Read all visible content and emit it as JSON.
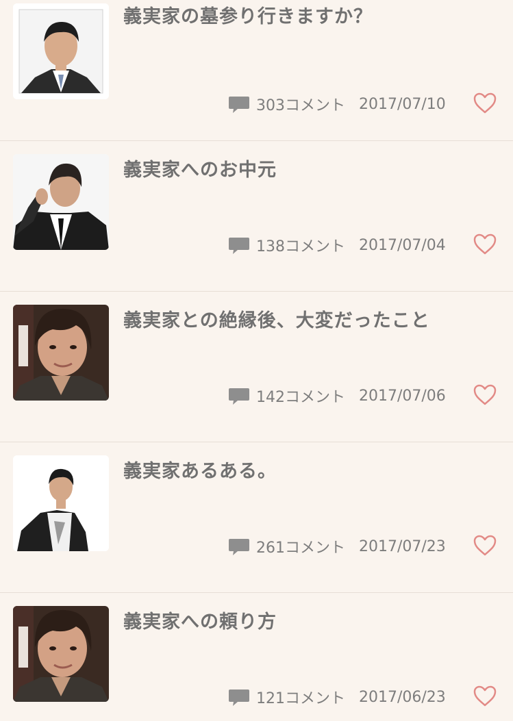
{
  "items": [
    {
      "title": "義実家の墓参り行きますか？",
      "comments": "303コメント",
      "date": "2017/07/10",
      "thumbnail": "man-suit-white-bg"
    },
    {
      "title": "義実家へのお中元",
      "comments": "138コメント",
      "date": "2017/07/04",
      "thumbnail": "man-suit-pose"
    },
    {
      "title": "義実家との絶縁後、大変だったこと",
      "comments": "142コメント",
      "date": "2017/07/06",
      "thumbnail": "man-closeup"
    },
    {
      "title": "義実家あるある。",
      "comments": "261コメント",
      "date": "2017/07/23",
      "thumbnail": "man-jacket-white-bg"
    },
    {
      "title": "義実家への頼り方",
      "comments": "121コメント",
      "date": "2017/06/23",
      "thumbnail": "man-closeup"
    }
  ],
  "icons": {
    "comment": "speech-bubble-icon",
    "like": "heart-outline-icon"
  },
  "colors": {
    "background": "#faf4ee",
    "text": "#707070",
    "heart": "#e28a86",
    "bubble": "#8e8e8e"
  }
}
